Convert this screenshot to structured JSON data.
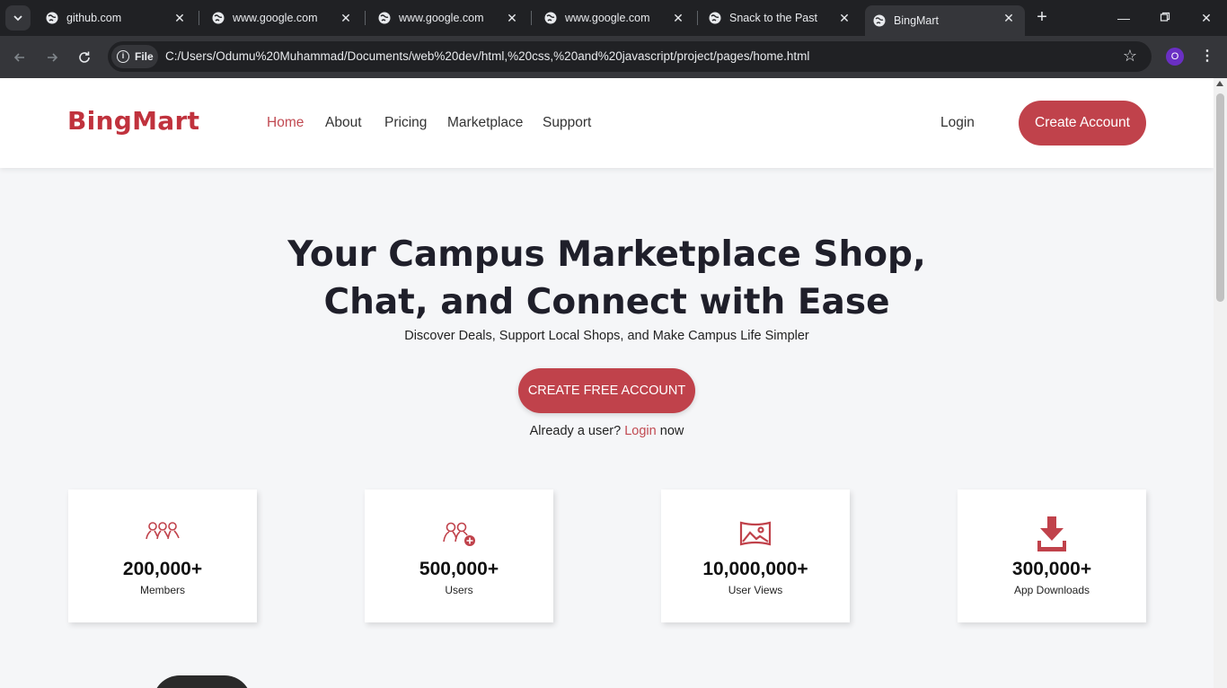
{
  "browser": {
    "tabs": [
      {
        "title": "github.com"
      },
      {
        "title": "www.google.com"
      },
      {
        "title": "www.google.com"
      },
      {
        "title": "www.google.com"
      },
      {
        "title": "Snack to the Past"
      },
      {
        "title": "BingMart"
      }
    ],
    "active_tab_index": 5,
    "site_chip": "File",
    "url": "C:/Users/Odumu%20Muhammad/Documents/web%20dev/html,%20css,%20and%20javascript/project/pages/home.html",
    "profile_initial": "O"
  },
  "header": {
    "logo": "BingMart",
    "nav": [
      {
        "label": "Home",
        "active": true
      },
      {
        "label": "About"
      },
      {
        "label": "Pricing"
      },
      {
        "label": "Marketplace"
      },
      {
        "label": "Support"
      }
    ],
    "login": "Login",
    "create_account": "Create Account"
  },
  "hero": {
    "title_line1": "Your Campus Marketplace Shop,",
    "title_line2": "Chat, and Connect with Ease",
    "subtitle": "Discover Deals, Support Local Shops, and Make Campus Life Simpler",
    "cta": "CREATE FREE ACCOUNT",
    "already_prefix": "Already a user?",
    "already_link": "Login",
    "already_suffix": "now"
  },
  "stats": [
    {
      "value": "200,000+",
      "label": "Members",
      "icon": "group-icon"
    },
    {
      "value": "500,000+",
      "label": "Users",
      "icon": "add-user-icon"
    },
    {
      "value": "10,000,000+",
      "label": "User Views",
      "icon": "image-icon"
    },
    {
      "value": "300,000+",
      "label": "App Downloads",
      "icon": "download-icon"
    }
  ],
  "colors": {
    "brand": "#c0323d",
    "button": "#c0424b",
    "link_active": "#c14a52"
  }
}
